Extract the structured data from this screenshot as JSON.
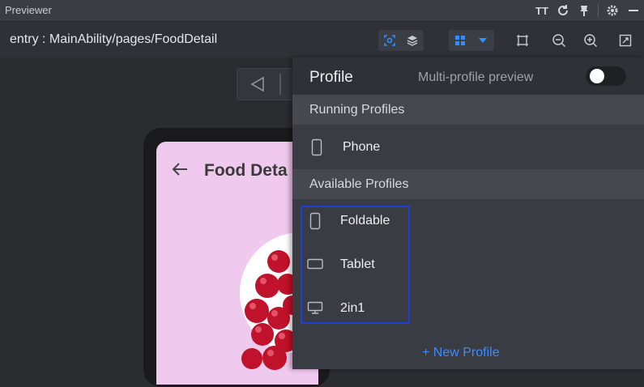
{
  "titlebar": {
    "title": "Previewer",
    "icons": [
      "font-size-icon",
      "refresh-icon",
      "pin-icon",
      "gear-icon",
      "minimize-icon"
    ],
    "font_size_glyph": "TT"
  },
  "toolbar": {
    "path": "entry : MainAbility/pages/FoodDetail",
    "icons": [
      "inspector-icon",
      "layers-icon",
      "grid-icon",
      "dropdown-icon",
      "frame-icon",
      "zoom-out-icon",
      "zoom-in-icon",
      "fit-screen-icon"
    ],
    "accent_color": "#1e90ff"
  },
  "preview": {
    "page_title": "Food Deta",
    "background_color": "#f0c9ee"
  },
  "profile_panel": {
    "title": "Profile",
    "multi_profile_label": "Multi-profile preview",
    "multi_profile_enabled": false,
    "running_section": "Running Profiles",
    "running_profiles": [
      {
        "name": "Phone",
        "icon": "phone-icon"
      }
    ],
    "available_section": "Available Profiles",
    "available_profiles": [
      {
        "name": "Foldable",
        "icon": "foldable-icon"
      },
      {
        "name": "Tablet",
        "icon": "tablet-icon"
      },
      {
        "name": "2in1",
        "icon": "monitor-icon"
      }
    ],
    "new_profile_label": "+ New Profile",
    "highlight_color": "#1e3fd6"
  }
}
